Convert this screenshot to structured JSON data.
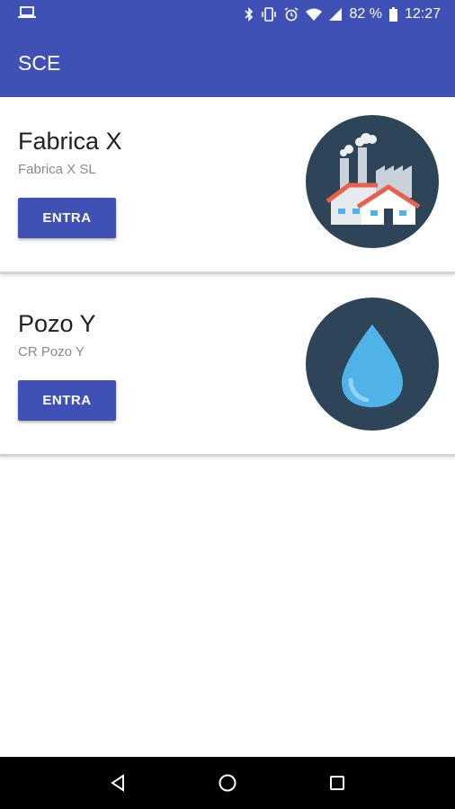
{
  "status_bar": {
    "battery_percent": "82 %",
    "time": "12:27",
    "icons": [
      "laptop-icon",
      "bluetooth-icon",
      "vibrate-icon",
      "alarm-icon",
      "wifi-icon",
      "signal-icon",
      "battery-icon"
    ]
  },
  "app_bar": {
    "title": "SCE"
  },
  "items": [
    {
      "title": "Fabrica X",
      "subtitle": "Fabrica X SL",
      "button_label": "ENTRA",
      "image_icon": "factory-icon"
    },
    {
      "title": "Pozo Y",
      "subtitle": "CR Pozo Y",
      "button_label": "ENTRA",
      "image_icon": "water-drop-icon"
    }
  ],
  "nav_bar": {
    "icons": [
      "back-icon",
      "home-icon",
      "recents-icon"
    ]
  },
  "colors": {
    "primary": "#3f51b5",
    "circle_bg": "#2e4458",
    "drop_blue": "#4fb3e8",
    "roof_red": "#e8614d"
  }
}
